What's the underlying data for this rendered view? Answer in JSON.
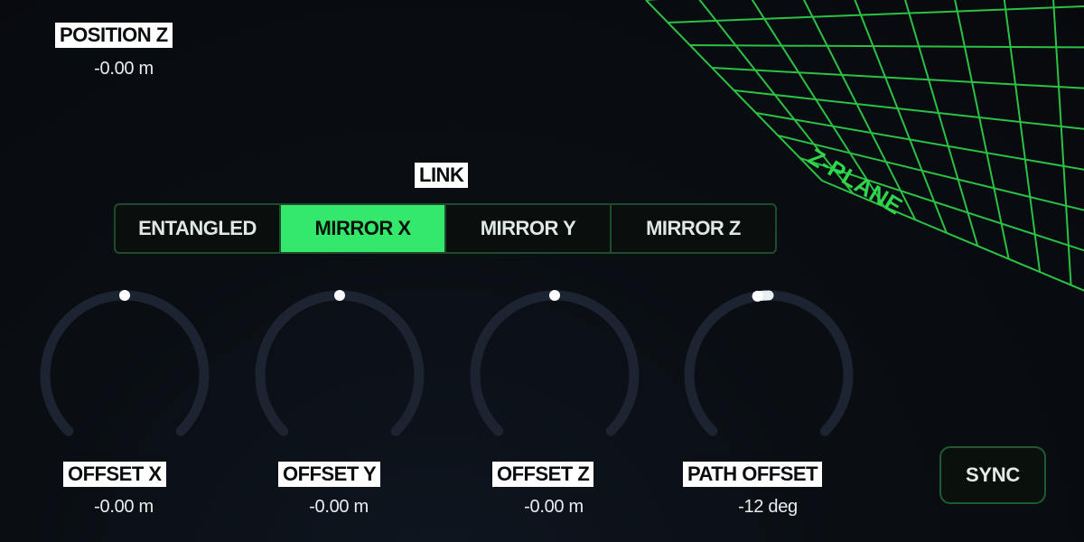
{
  "position_z": {
    "label": "POSITION Z",
    "value": "-0.00 m"
  },
  "zplane": {
    "label": "Z-PLANE",
    "grid_color": "#2fd54a"
  },
  "link": {
    "label": "LINK",
    "options": [
      {
        "label": "ENTANGLED",
        "active": false
      },
      {
        "label": "MIRROR X",
        "active": true
      },
      {
        "label": "MIRROR Y",
        "active": false
      },
      {
        "label": "MIRROR Z",
        "active": false
      }
    ],
    "active_color": "#33e86b"
  },
  "knobs": [
    {
      "label": "OFFSET X",
      "value": "-0.00 m",
      "level": 0.5
    },
    {
      "label": "OFFSET Y",
      "value": "-0.00 m",
      "level": 0.5
    },
    {
      "label": "OFFSET Z",
      "value": "-0.00 m",
      "level": 0.5
    },
    {
      "label": "PATH OFFSET",
      "value": "-12 deg",
      "level": 0.47
    }
  ],
  "sync": {
    "label": "SYNC"
  }
}
